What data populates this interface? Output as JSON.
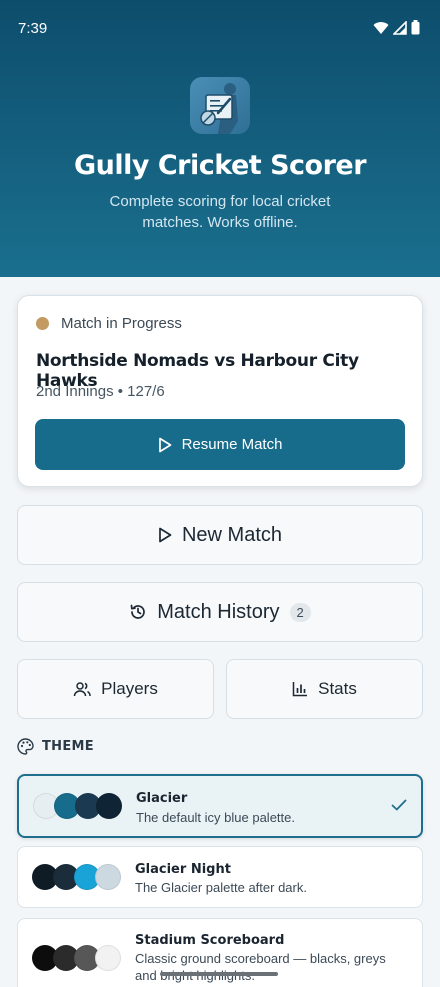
{
  "status_bar": {
    "time": "7:39"
  },
  "header": {
    "title": "Gully Cricket Scorer",
    "subtitle": "Complete scoring for local cricket matches. Works offline."
  },
  "match_in_progress": {
    "status_label": "Match in Progress",
    "status_color": "#c39a62",
    "teams": "Northside Nomads vs Harbour City Hawks",
    "details": "2nd Innings • 127/6",
    "resume_label": "Resume Match"
  },
  "actions": {
    "new_match_label": "New Match",
    "history_label": "Match History",
    "history_count": "2",
    "players_label": "Players",
    "stats_label": "Stats"
  },
  "theme": {
    "heading": "THEME",
    "options": [
      {
        "name": "Glacier",
        "description": "The default icy blue palette.",
        "selected": true,
        "swatches": [
          "#e6eef2",
          "#176b8b",
          "#1b3a52",
          "#0f2535"
        ]
      },
      {
        "name": "Glacier Night",
        "description": "The Glacier palette after dark.",
        "selected": false,
        "swatches": [
          "#0f1c26",
          "#1b2d3b",
          "#1aa3d6",
          "#cdd9e0"
        ]
      },
      {
        "name": "Stadium Scoreboard",
        "description": "Classic ground scoreboard — blacks, greys and bright highlights.",
        "selected": false,
        "swatches": [
          "#0d0d0d",
          "#2b2b2b",
          "#575757",
          "#f2f2f2"
        ]
      }
    ]
  },
  "colors": {
    "accent": "#176b8b",
    "header_bg": "#0d4d6c"
  }
}
